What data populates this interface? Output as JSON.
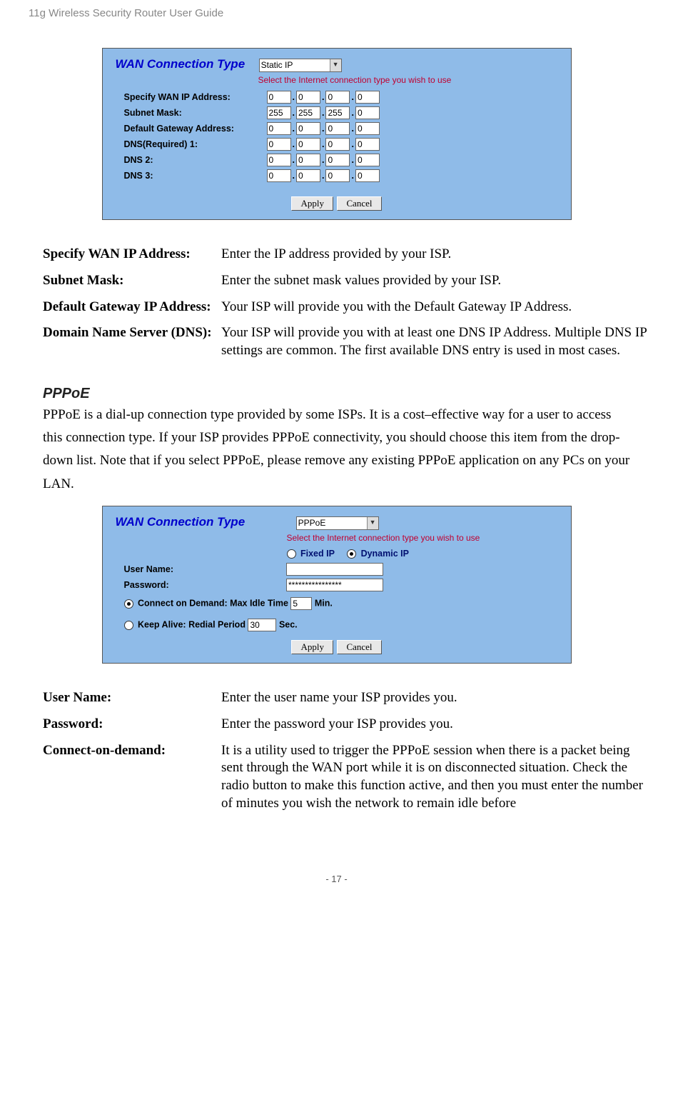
{
  "header": "11g Wireless Security Router User Guide",
  "page_number": "- 17 -",
  "panel_static": {
    "title": "WAN Connection Type",
    "select_value": "Static IP",
    "hint": "Select the Internet connection type you wish to use",
    "rows": [
      {
        "label": "Specify WAN IP Address:",
        "v": [
          "0",
          "0",
          "0",
          "0"
        ]
      },
      {
        "label": "Subnet Mask:",
        "v": [
          "255",
          "255",
          "255",
          "0"
        ]
      },
      {
        "label": "Default Gateway Address:",
        "v": [
          "0",
          "0",
          "0",
          "0"
        ]
      },
      {
        "label": "DNS(Required)  1:",
        "v": [
          "0",
          "0",
          "0",
          "0"
        ]
      },
      {
        "label": "DNS   2:",
        "v": [
          "0",
          "0",
          "0",
          "0"
        ]
      },
      {
        "label": "DNS   3:",
        "v": [
          "0",
          "0",
          "0",
          "0"
        ]
      }
    ],
    "apply": "Apply",
    "cancel": "Cancel"
  },
  "defs_static": [
    {
      "term": "Specify WAN IP Address:",
      "desc": "Enter the IP address provided by your ISP."
    },
    {
      "term": "Subnet Mask:",
      "desc": "Enter the subnet mask values provided by your ISP."
    },
    {
      "term": "Default Gateway IP Address:",
      "desc": "Your ISP will provide you with the Default Gateway IP Address."
    },
    {
      "term": "Domain Name Server (DNS):",
      "desc": "Your ISP will provide you with at least one DNS IP Address. Multiple DNS IP settings are common. The first available DNS entry is used in most cases."
    }
  ],
  "pppoe_heading": "PPPoE",
  "pppoe_text": "PPPoE is a dial-up connection type provided by some ISPs. It is a cost–effective way for a user to access this connection type. If your ISP provides PPPoE connectivity, you should choose this item from the drop-down list. Note that if you select PPPoE, please remove any existing PPPoE application on any PCs on your LAN.",
  "panel_pppoe": {
    "title": "WAN Connection Type",
    "select_value": "PPPoE",
    "hint": "Select the Internet connection type you wish to use",
    "fixed": "Fixed IP",
    "dynamic": "Dynamic IP",
    "user_label": "User Name:",
    "user_value": "",
    "pass_label": "Password:",
    "pass_value": "****************",
    "cod_label": "Connect on Demand: Max Idle Time",
    "cod_value": "5",
    "cod_unit": "Min.",
    "ka_label": "Keep Alive: Redial Period",
    "ka_value": "30",
    "ka_unit": "Sec.",
    "apply": "Apply",
    "cancel": "Cancel"
  },
  "defs_pppoe": [
    {
      "term": "User Name:",
      "desc": "Enter the user name your ISP provides you."
    },
    {
      "term": "Password:",
      "desc": "Enter the password your ISP provides you."
    },
    {
      "term": "Connect-on-demand:",
      "desc": "It is a utility used to trigger the PPPoE session when there is a packet being sent through the WAN port while it is on disconnected situation. Check the radio button to make this function active, and then you must enter the number of minutes you wish the network to remain idle before"
    }
  ]
}
